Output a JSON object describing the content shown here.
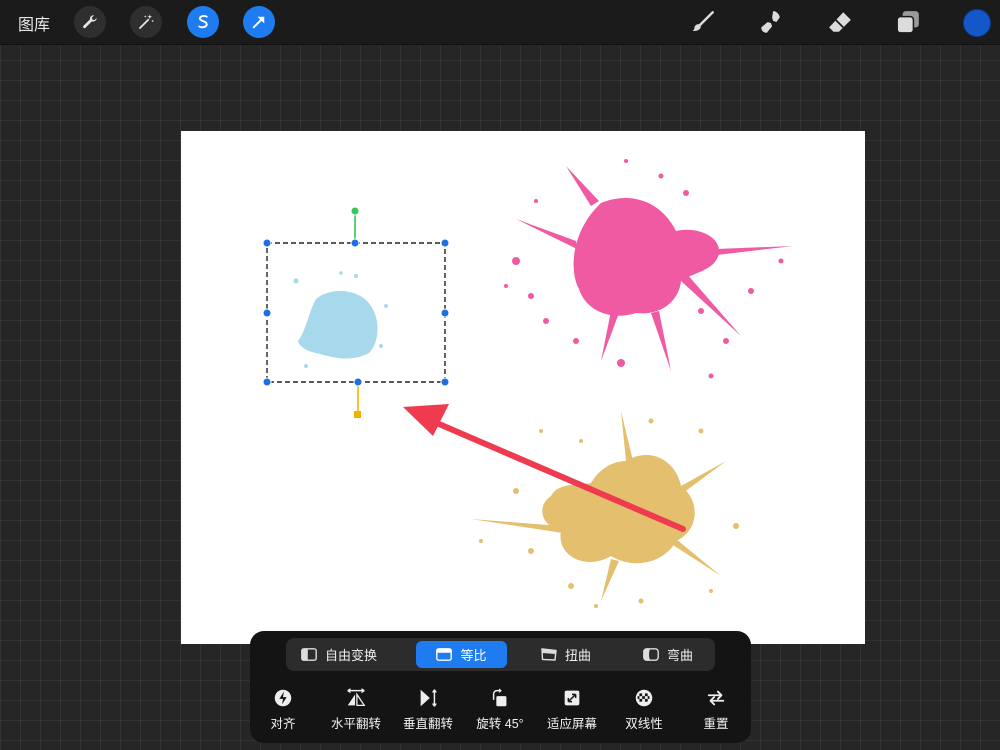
{
  "topbar": {
    "gallery_label": "图库",
    "left_tools": [
      {
        "icon": "wrench-icon",
        "active": false
      },
      {
        "icon": "magic-wand-icon",
        "active": false
      },
      {
        "icon": "selection-s-icon",
        "active": true
      },
      {
        "icon": "transform-arrow-icon",
        "active": true
      }
    ],
    "right_tools": [
      "brush-icon",
      "smudge-icon",
      "eraser-icon",
      "layers-icon"
    ],
    "current_color": "#1457c8"
  },
  "canvas": {
    "background": "#ffffff",
    "splashes": [
      {
        "name": "blue-splash",
        "color": "#a7d8ec",
        "selected": true
      },
      {
        "name": "pink-splash",
        "color": "#ef5aa2",
        "selected": false
      },
      {
        "name": "yellow-splash",
        "color": "#e3bf6e",
        "selected": false
      }
    ],
    "annotation_arrow_color": "#ee3b4f",
    "selection_accent": "#1e6fe0"
  },
  "transform_panel": {
    "modes": [
      {
        "label": "自由变换",
        "active": false
      },
      {
        "label": "等比",
        "active": true
      },
      {
        "label": "扭曲",
        "active": false
      },
      {
        "label": "弯曲",
        "active": false
      }
    ],
    "actions": [
      {
        "label": "对齐",
        "icon": "magnet-icon"
      },
      {
        "label": "水平翻转",
        "icon": "flip-horizontal-icon"
      },
      {
        "label": "垂直翻转",
        "icon": "flip-vertical-icon"
      },
      {
        "label": "旋转 45°",
        "icon": "rotate-icon"
      },
      {
        "label": "适应屏幕",
        "icon": "fit-screen-icon"
      },
      {
        "label": "双线性",
        "icon": "bilinear-icon"
      },
      {
        "label": "重置",
        "icon": "reset-icon"
      }
    ]
  }
}
